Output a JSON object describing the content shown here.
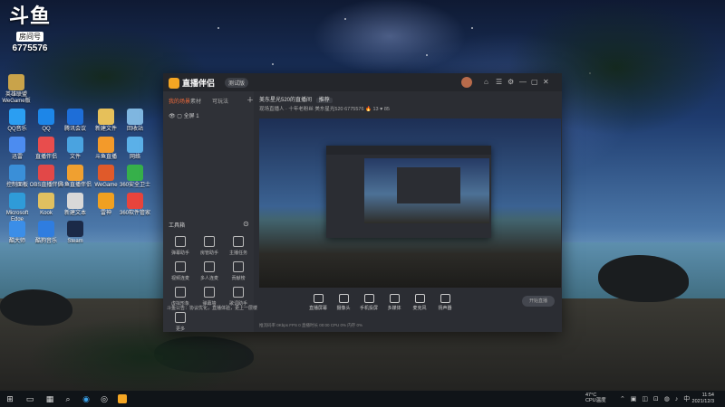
{
  "overlay": {
    "logo_text": "斗鱼",
    "room_label": "房间号",
    "room_number": "6775576"
  },
  "desktop_icons": [
    {
      "label": "英雄联盟\nWeGame版",
      "color": "#c9a34a"
    },
    {
      "label": "QQ音乐",
      "color": "#2b9ef2"
    },
    {
      "label": "QQ",
      "color": "#1d86e8"
    },
    {
      "label": "腾讯会议",
      "color": "#1e6ed8"
    },
    {
      "label": "新建文件",
      "color": "#e6c05a"
    },
    {
      "label": "回收站",
      "color": "#7fb6e0"
    },
    {
      "label": "迅雷",
      "color": "#4c8cf0"
    },
    {
      "label": "直播伴侣",
      "color": "#e84d4d"
    },
    {
      "label": "文件",
      "color": "#4aa3e0"
    },
    {
      "label": "斗鱼直播",
      "color": "#f39a2a"
    },
    {
      "label": "网络",
      "color": "#5bb0e8"
    },
    {
      "label": "控制面板",
      "color": "#3a8fd8"
    },
    {
      "label": "OBS直播伴侣",
      "color": "#e24848"
    },
    {
      "label": "斗鱼直播伴侣",
      "color": "#f0a030"
    },
    {
      "label": "WeGame",
      "color": "#e05a2a"
    },
    {
      "label": "360安全卫士",
      "color": "#36b04a"
    },
    {
      "label": "Microsoft Edge",
      "color": "#2f9bd8"
    },
    {
      "label": "Kook",
      "color": "#e0c060"
    },
    {
      "label": "新建文本",
      "color": "#d8d8d8"
    },
    {
      "label": "雷神",
      "color": "#f0a020"
    },
    {
      "label": "360软件管家",
      "color": "#e8443c"
    },
    {
      "label": "酷大师",
      "color": "#3b8ee8"
    },
    {
      "label": "酷狗音乐",
      "color": "#2f7de0"
    },
    {
      "label": "Steam",
      "color": "#1b2a48"
    }
  ],
  "app": {
    "name": "直播伴侣",
    "version": "测试版",
    "window_controls": [
      "⌂",
      "☰",
      "⚙",
      "—",
      "▢",
      "✕"
    ],
    "left_tabs": [
      "我的场景",
      "素材",
      "可玩法"
    ],
    "active_tab_index": 0,
    "scene_item": "全屏 1",
    "tools_title": "工具箱",
    "tools": [
      "弹幕助手",
      "房管助手",
      "主播任务",
      "视频连麦",
      "多人连麦",
      "贡献榜",
      "虚拟形象",
      "弹幕墙",
      "歌词助手",
      "更多"
    ],
    "notice": "斗鱼公告：协议优化，直播体验，更上一层楼",
    "room_title": "美东星光520的直播间",
    "room_tag": "推荐",
    "room_meta": "现场直播人 · 十年老粉丝    美东星光520  6775576    🔥 13    ♥ 85",
    "bottom_buttons": [
      "直播屏幕",
      "摄像头",
      "手机投屏",
      "多媒体",
      "麦克风",
      "扬声器"
    ],
    "start_button": "开始直播",
    "status_row": "推流码率 0Kbps    FPS 0    直播时长 00:00    CPU 0%    内存 0%"
  },
  "taskbar": {
    "weather": "47°C",
    "weather_label": "CPU温度",
    "time": "11:54",
    "date": "2021/12/3"
  }
}
